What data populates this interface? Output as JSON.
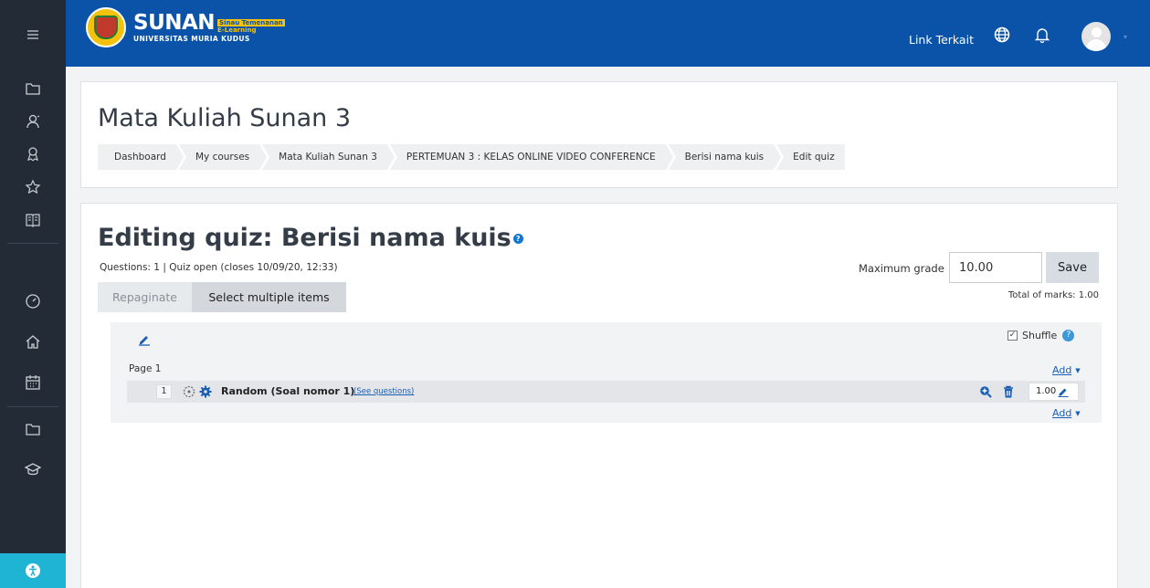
{
  "navbar": {
    "brand_name": "SUNAN",
    "brand_tagline_1": "Sinau Temenanan",
    "brand_tagline_2": "E-Learning",
    "brand_subtitle": "UNIVERSITAS MURIA KUDUS",
    "link_terkait": "Link Terkait",
    "icons": [
      "language-globe-icon",
      "notification-bell-icon",
      "user-avatar"
    ]
  },
  "sidebar": {
    "items": [
      "folder-icon",
      "participants-icon",
      "badges-icon",
      "competencies-star-icon",
      "grades-book-icon",
      "dashboard-gauge-icon",
      "site-home-icon",
      "calendar-icon",
      "private-files-folder-icon",
      "my-courses-mortarboard-icon"
    ],
    "accessibility_icon": "accessibility-icon"
  },
  "header": {
    "course_title": "Mata Kuliah Sunan 3",
    "breadcrumb": [
      "Dashboard",
      "My courses",
      "Mata Kuliah Sunan 3",
      "PERTEMUAN 3 : KELAS ONLINE VIDEO CONFERENCE",
      "Berisi nama kuis",
      "Edit quiz"
    ]
  },
  "quiz": {
    "title": "Editing quiz: Berisi nama kuis",
    "info": "Questions: 1 | Quiz open (closes 10/09/20, 12:33)",
    "max_grade_label": "Maximum grade",
    "max_grade_value": "10.00",
    "save_label": "Save",
    "total_marks": "Total of marks: 1.00",
    "repaginate_label": "Repaginate",
    "select_multiple_label": "Select multiple items",
    "shuffle_label": "Shuffle",
    "page_label": "Page 1",
    "add_label": "Add",
    "questions": [
      {
        "slot": "1",
        "name": "Random (Soal nomor 1)",
        "link": "(See questions)",
        "mark": "1.00"
      }
    ]
  },
  "colors": {
    "navbar_bg": "#0b53a8",
    "sidebar_bg": "#232c36",
    "accessibility_bg": "#1fb4d4",
    "link": "#1a5fb4"
  }
}
